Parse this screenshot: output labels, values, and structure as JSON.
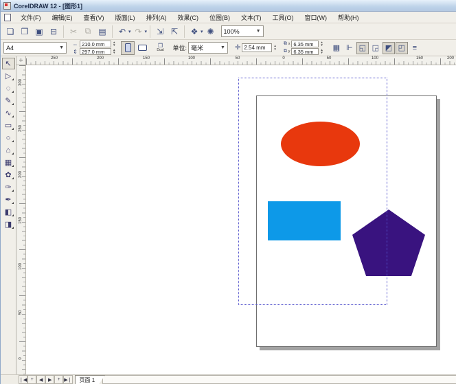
{
  "window": {
    "title": "CorelDRAW 12 - [图形1]"
  },
  "menu": {
    "items": [
      "文件(F)",
      "编辑(E)",
      "查看(V)",
      "版面(L)",
      "排列(A)",
      "效果(C)",
      "位图(B)",
      "文本(T)",
      "工具(O)",
      "窗口(W)",
      "帮助(H)"
    ]
  },
  "toolbar": {
    "buttons": [
      {
        "name": "new-document",
        "glyph": "❏"
      },
      {
        "name": "open",
        "glyph": "❒"
      },
      {
        "name": "save",
        "glyph": "▣"
      },
      {
        "name": "print",
        "glyph": "⊟"
      },
      {
        "name": "cut",
        "glyph": "✂"
      },
      {
        "name": "copy",
        "glyph": "⧉"
      },
      {
        "name": "paste",
        "glyph": "▤"
      },
      {
        "name": "undo",
        "glyph": "↶"
      },
      {
        "name": "redo",
        "glyph": "↷"
      },
      {
        "name": "import",
        "glyph": "⇲"
      },
      {
        "name": "export",
        "glyph": "⇱"
      },
      {
        "name": "application-launcher",
        "glyph": "❖"
      },
      {
        "name": "corel-online",
        "glyph": "✺"
      }
    ],
    "zoom_level": "100%"
  },
  "property_bar": {
    "paper_type": "A4",
    "paper_width": "210.0 mm",
    "paper_height": "297.0 mm",
    "dual_label": "Dual",
    "units_label": "单位:",
    "units_value": "毫米",
    "nudge_offset": "2.54 mm",
    "duplicate_x_label": "x",
    "duplicate_x": "6.35 mm",
    "duplicate_y_label": "y",
    "duplicate_y": "6.35 mm",
    "snap_buttons": [
      {
        "name": "snap-to-grid",
        "glyph": "▦"
      },
      {
        "name": "snap-to-guidelines",
        "glyph": "⊩"
      },
      {
        "name": "snap-to-objects",
        "glyph": "◱"
      },
      {
        "name": "snap-to-dynamic-guides",
        "glyph": "◲"
      },
      {
        "name": "treat-as-filled",
        "glyph": "◩"
      },
      {
        "name": "marquee-select",
        "glyph": "◰"
      },
      {
        "name": "properties",
        "glyph": "≡"
      }
    ]
  },
  "rulers": {
    "origin_glyph": "✛",
    "top_labels": [
      "250",
      "200",
      "150",
      "100",
      "50",
      "0",
      "50",
      "100",
      "150",
      "200"
    ],
    "left_labels": [
      "300",
      "250",
      "200",
      "150",
      "100",
      "50",
      "0"
    ]
  },
  "toolbox": {
    "tools": [
      {
        "name": "pick-tool",
        "glyph": "↖"
      },
      {
        "name": "shape-tool",
        "glyph": "▷"
      },
      {
        "name": "zoom-tool",
        "glyph": "◌"
      },
      {
        "name": "freehand-tool",
        "glyph": "✎"
      },
      {
        "name": "smart-drawing-tool",
        "glyph": "∿"
      },
      {
        "name": "rectangle-tool",
        "glyph": "▭"
      },
      {
        "name": "ellipse-tool",
        "glyph": "○"
      },
      {
        "name": "polygon-tool",
        "glyph": "⌂"
      },
      {
        "name": "graph-paper-tool",
        "glyph": "▦"
      },
      {
        "name": "basic-shapes-tool",
        "glyph": "✿"
      },
      {
        "name": "eyedropper-tool",
        "glyph": "✑"
      },
      {
        "name": "outline-tool",
        "glyph": "✒"
      },
      {
        "name": "fill-tool",
        "glyph": "◧"
      },
      {
        "name": "interactive-fill-tool",
        "glyph": "◨"
      }
    ]
  },
  "canvas": {
    "shapes": {
      "ellipse_color": "#E8380D",
      "rectangle_color": "#0D99E8",
      "pentagon_color": "#39137F"
    },
    "marquee_color": "#5353CC"
  },
  "pagebar": {
    "nav": [
      {
        "name": "first-page",
        "glyph": "❘◀"
      },
      {
        "name": "add-page-before",
        "glyph": "+"
      },
      {
        "name": "prev-page",
        "glyph": "◀"
      },
      {
        "name": "next-page",
        "glyph": "▶"
      },
      {
        "name": "add-page-after",
        "glyph": "+"
      },
      {
        "name": "last-page",
        "glyph": "▶❘"
      }
    ],
    "tab": "页面 1"
  }
}
